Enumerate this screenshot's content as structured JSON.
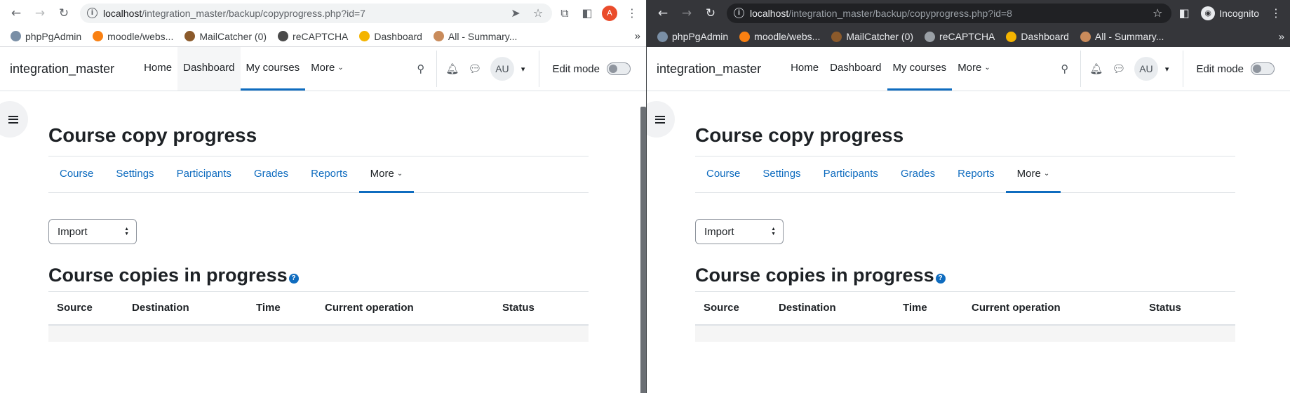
{
  "windows": [
    {
      "id": "left",
      "theme": "light",
      "browser": {
        "url_host": "localhost",
        "url_path": "/integration_master/backup/copyprogress.php?id=7",
        "profile_initial": "A",
        "bookmarks": [
          {
            "label": "phpPgAdmin",
            "color": "#7a8fa6"
          },
          {
            "label": "moodle/webs...",
            "color": "#f98012"
          },
          {
            "label": "MailCatcher (0)",
            "color": "#8b5a2b"
          },
          {
            "label": "reCAPTCHA",
            "color": "#4a4a4a"
          },
          {
            "label": "Dashboard",
            "color": "#f4b400"
          },
          {
            "label": "All - Summary...",
            "color": "#c98b5b"
          }
        ],
        "bookmarks_overflow": "»"
      },
      "moodle": {
        "site_name": "integration_master",
        "primary_nav": [
          {
            "label": "Home",
            "state": ""
          },
          {
            "label": "Dashboard",
            "state": "hovered"
          },
          {
            "label": "My courses",
            "state": "active"
          },
          {
            "label": "More",
            "state": "",
            "caret": true
          }
        ],
        "user_initials": "AU",
        "edit_mode_label": "Edit mode",
        "page_title": "Course copy progress",
        "secondary_nav": [
          "Course",
          "Settings",
          "Participants",
          "Grades",
          "Reports"
        ],
        "secondary_more": "More",
        "select_value": "Import",
        "section_heading": "Course copies in progress",
        "help_glyph": "?",
        "table_headers": [
          "Source",
          "Destination",
          "Time",
          "Current operation",
          "Status"
        ]
      }
    },
    {
      "id": "right",
      "theme": "dark",
      "browser": {
        "url_host": "localhost",
        "url_path": "/integration_master/backup/copyprogress.php?id=8",
        "incognito_label": "Incognito",
        "bookmarks": [
          {
            "label": "phpPgAdmin",
            "color": "#7a8fa6"
          },
          {
            "label": "moodle/webs...",
            "color": "#f98012"
          },
          {
            "label": "MailCatcher (0)",
            "color": "#8b5a2b"
          },
          {
            "label": "reCAPTCHA",
            "color": "#9aa0a6"
          },
          {
            "label": "Dashboard",
            "color": "#f4b400"
          },
          {
            "label": "All - Summary...",
            "color": "#c98b5b"
          }
        ],
        "bookmarks_overflow": "»"
      },
      "moodle": {
        "site_name": "integration_master",
        "primary_nav": [
          {
            "label": "Home",
            "state": ""
          },
          {
            "label": "Dashboard",
            "state": ""
          },
          {
            "label": "My courses",
            "state": "active"
          },
          {
            "label": "More",
            "state": "",
            "caret": true
          }
        ],
        "user_initials": "AU",
        "edit_mode_label": "Edit mode",
        "page_title": "Course copy progress",
        "secondary_nav": [
          "Course",
          "Settings",
          "Participants",
          "Grades",
          "Reports"
        ],
        "secondary_more": "More",
        "select_value": "Import",
        "section_heading": "Course copies in progress",
        "help_glyph": "?",
        "table_headers": [
          "Source",
          "Destination",
          "Time",
          "Current operation",
          "Status"
        ]
      }
    }
  ],
  "colors": {
    "accent": "#0f6cbf",
    "text": "#1d2125",
    "border": "#dee2e6"
  }
}
